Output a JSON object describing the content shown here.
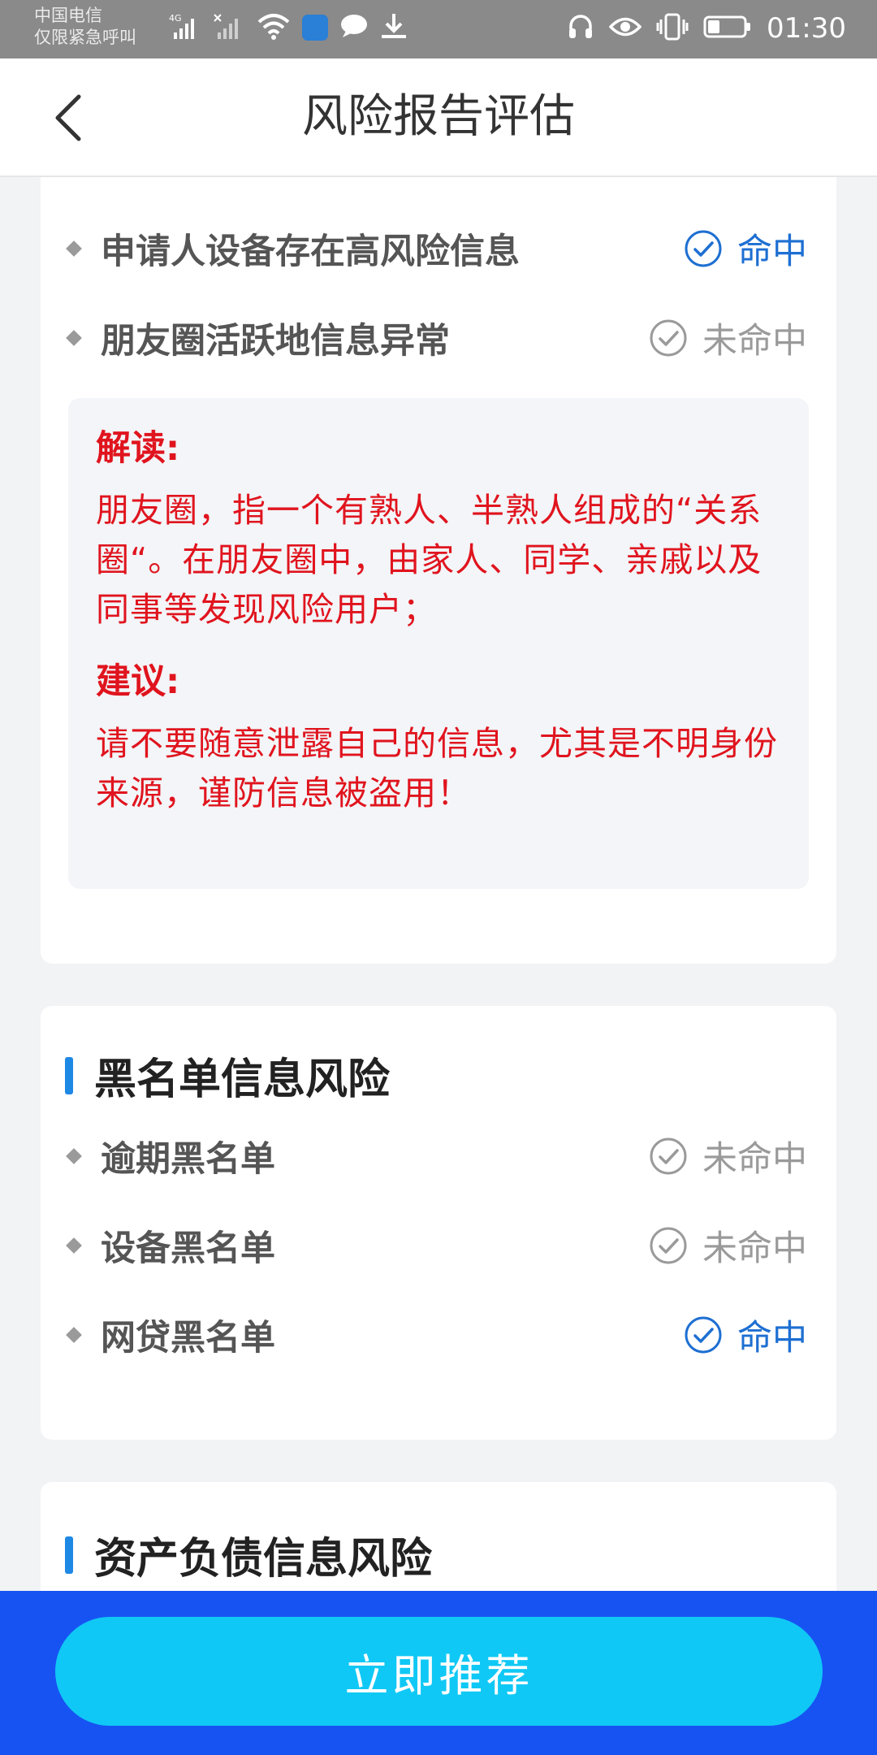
{
  "status_bar": {
    "carrier_line1": "中国电信",
    "carrier_line2": "仅限紧急呼叫",
    "network_label": "4G",
    "time": "01:30"
  },
  "nav": {
    "title": "风险报告评估"
  },
  "card1": {
    "rows": [
      {
        "label": "申请人设备存在高风险信息",
        "status": "命中",
        "hit": true
      },
      {
        "label": "朋友圈活跃地信息异常",
        "status": "未命中",
        "hit": false
      }
    ],
    "explain": {
      "heading1": "解读:",
      "body1": "朋友圈，指一个有熟人、半熟人组成的“关系圈“。在朋友圈中，由家人、同学、亲戚以及同事等发现风险用户；",
      "heading2": "建议:",
      "body2": "请不要随意泄露自己的信息，尤其是不明身份来源，谨防信息被盗用！"
    }
  },
  "card2": {
    "title": "黑名单信息风险",
    "rows": [
      {
        "label": "逾期黑名单",
        "status": "未命中",
        "hit": false
      },
      {
        "label": "设备黑名单",
        "status": "未命中",
        "hit": false
      },
      {
        "label": "网贷黑名单",
        "status": "命中",
        "hit": true
      }
    ]
  },
  "card3": {
    "title": "资产负债信息风险"
  },
  "cta": {
    "label": "立即推荐"
  },
  "colors": {
    "hit": "#1e6fd2",
    "miss": "#9a9a9a",
    "explain_text": "#e0141e",
    "accent_bar": "#1e88e5",
    "cta_bg": "#10c8f5",
    "bottom_bar": "#1753f2"
  }
}
